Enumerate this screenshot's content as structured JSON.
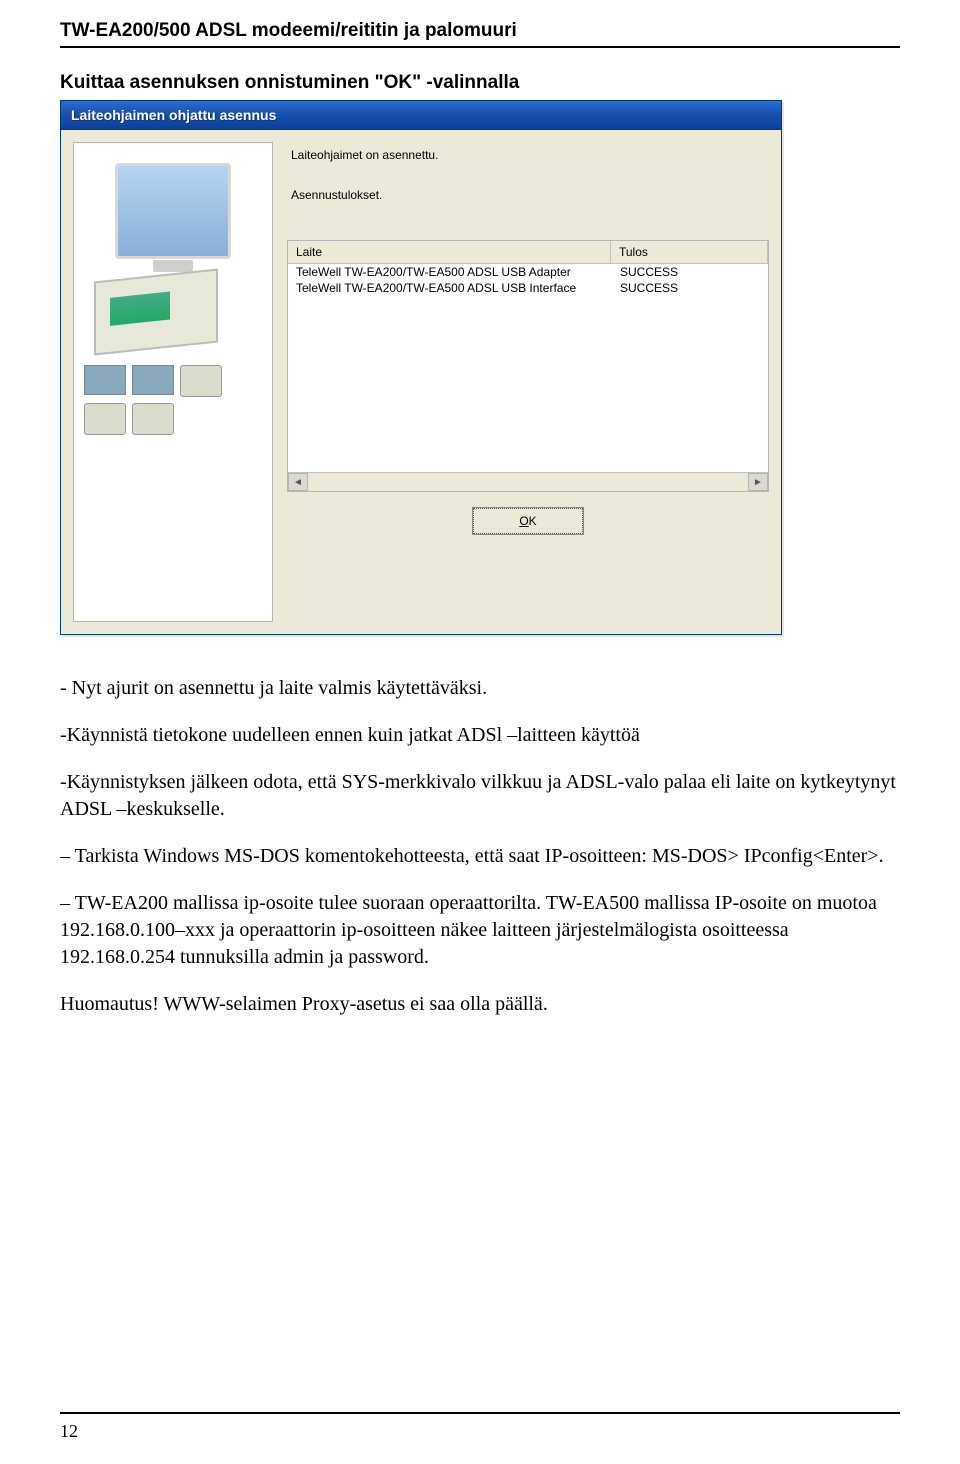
{
  "header": {
    "title": "TW-EA200/500 ADSL modeemi/reititin ja palomuuri"
  },
  "subheading": "Kuittaa asennuksen onnistuminen \"OK\" -valinnalla",
  "dialog": {
    "title": "Laiteohjaimen ohjattu asennus",
    "msg1": "Laiteohjaimet on asennettu.",
    "msg2": "Asennustulokset.",
    "columns": {
      "device": "Laite",
      "result": "Tulos"
    },
    "rows": [
      {
        "device": "TeleWell TW-EA200/TW-EA500 ADSL USB Adapter",
        "result": "SUCCESS"
      },
      {
        "device": "TeleWell TW-EA200/TW-EA500 ADSL USB Interface",
        "result": "SUCCESS"
      }
    ],
    "ok_label": "OK",
    "ok_accesskey_prefix": ""
  },
  "body": {
    "p1": "- Nyt ajurit on asennettu ja laite valmis käytettäväksi.",
    "p2": "-Käynnistä tietokone uudelleen ennen kuin jatkat ADSl –laitteen käyttöä",
    "p3": "-Käynnistyksen jälkeen odota, että SYS-merkkivalo vilkkuu ja ADSL-valo palaa eli laite on kytkeytynyt ADSL –keskukselle.",
    "p4": "– Tarkista Windows MS-DOS komentokehotteesta, että saat IP-osoitteen: MS-DOS> IPconfig<Enter>.",
    "p5": "– TW-EA200 mallissa ip-osoite tulee suoraan operaattorilta. TW-EA500 mallissa IP-osoite on muotoa 192.168.0.100–xxx ja operaattorin ip-osoitteen näkee laitteen järjestelmälogista osoitteessa 192.168.0.254 tunnuksilla admin ja password.",
    "p6": "Huomautus!  WWW-selaimen Proxy-asetus ei saa olla päällä."
  },
  "page_number": "12"
}
